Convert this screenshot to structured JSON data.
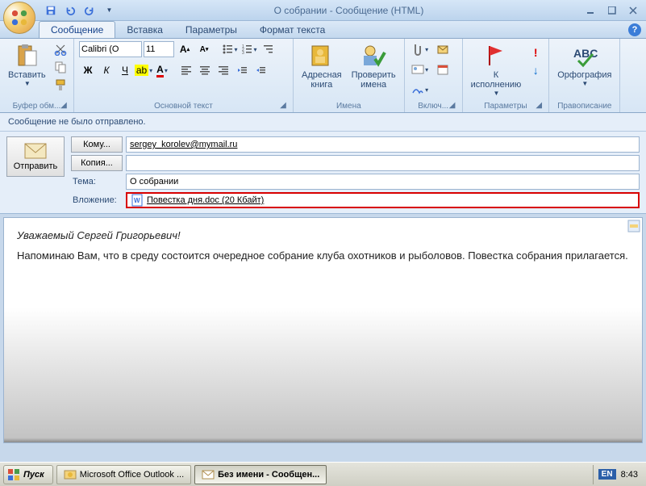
{
  "window": {
    "title": "О собрании - Сообщение (HTML)"
  },
  "tabs": {
    "message": "Сообщение",
    "insert": "Вставка",
    "options": "Параметры",
    "format": "Формат текста"
  },
  "ribbon": {
    "clipboard": {
      "paste": "Вставить",
      "label": "Буфер обм..."
    },
    "font": {
      "name": "Calibri (О",
      "size": "11",
      "label": "Основной текст"
    },
    "names": {
      "addressbook": "Адресная\nкнига",
      "checknames": "Проверить\nимена",
      "label": "Имена"
    },
    "include": {
      "label": "Включ..."
    },
    "followup": {
      "flag": "К\nисполнению",
      "label": "Параметры"
    },
    "proofing": {
      "spelling": "Орфография",
      "label": "Правописание"
    }
  },
  "infobar": "Сообщение не было отправлено.",
  "header": {
    "send": "Отправить",
    "to_btn": "Кому...",
    "cc_btn": "Копия...",
    "subject_lbl": "Тема:",
    "attach_lbl": "Вложение:",
    "to_value": "sergey_korolev@mymail.ru",
    "cc_value": "",
    "subject_value": "О собрании",
    "attachment": {
      "name": "Повестка дня.doc",
      "size": "(20 Кбайт)"
    }
  },
  "body": {
    "greeting": "Уважаемый Сергей Григорьевич!",
    "text": "Напоминаю  Вам, что в среду состоится очередное собрание клуба охотников и рыболовов. Повестка собрания прилагается."
  },
  "taskbar": {
    "start": "Пуск",
    "task1": "Microsoft Office Outlook ...",
    "task2": "Без имени - Сообщен...",
    "lang": "EN",
    "clock": "8:43"
  }
}
